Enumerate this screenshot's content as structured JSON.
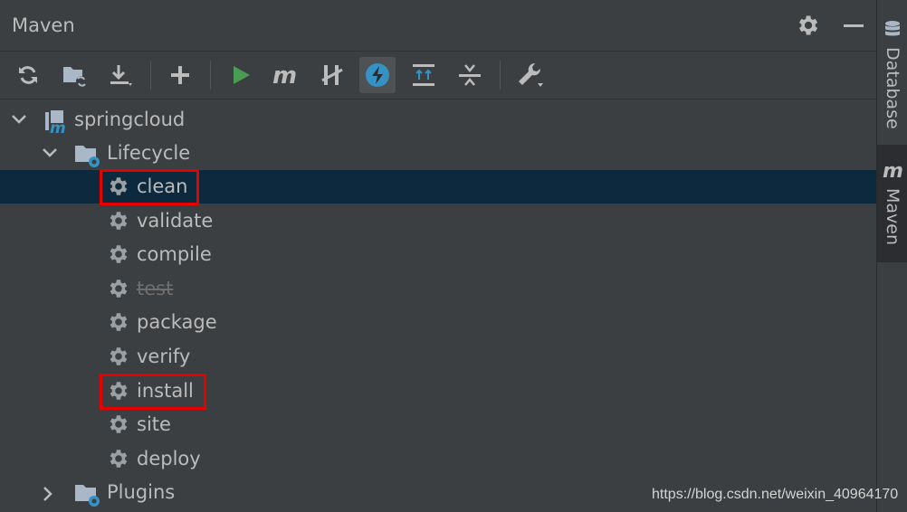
{
  "header": {
    "title": "Maven"
  },
  "toolbar": {
    "buttons": [
      {
        "icon": "reload-icon"
      },
      {
        "icon": "generate-sources-icon"
      },
      {
        "icon": "download-icon"
      },
      {
        "icon": "add-icon"
      },
      {
        "icon": "run-icon"
      },
      {
        "icon": "maven-goal-icon"
      },
      {
        "icon": "toggle-offline-icon"
      },
      {
        "icon": "skip-tests-icon",
        "active": true
      },
      {
        "icon": "show-dependencies-icon"
      },
      {
        "icon": "collapse-all-icon"
      },
      {
        "icon": "settings-wrench-icon"
      }
    ]
  },
  "tree": {
    "project": "springcloud",
    "lifecycle": {
      "label": "Lifecycle",
      "goals": [
        "clean",
        "validate",
        "compile",
        "test",
        "package",
        "verify",
        "install",
        "site",
        "deploy"
      ],
      "selected": "clean",
      "disabled": [
        "test"
      ],
      "highlighted": [
        "clean",
        "install"
      ]
    },
    "plugins": "Plugins"
  },
  "right_tabs": {
    "database": "Database",
    "maven": "Maven"
  },
  "watermark": "https://blog.csdn.net/weixin_40964170",
  "colors": {
    "background": "#3c3f41",
    "selection": "#0d293e",
    "highlight": "#e60000",
    "run_green": "#499c54",
    "icon_blue": "#3592c4"
  }
}
